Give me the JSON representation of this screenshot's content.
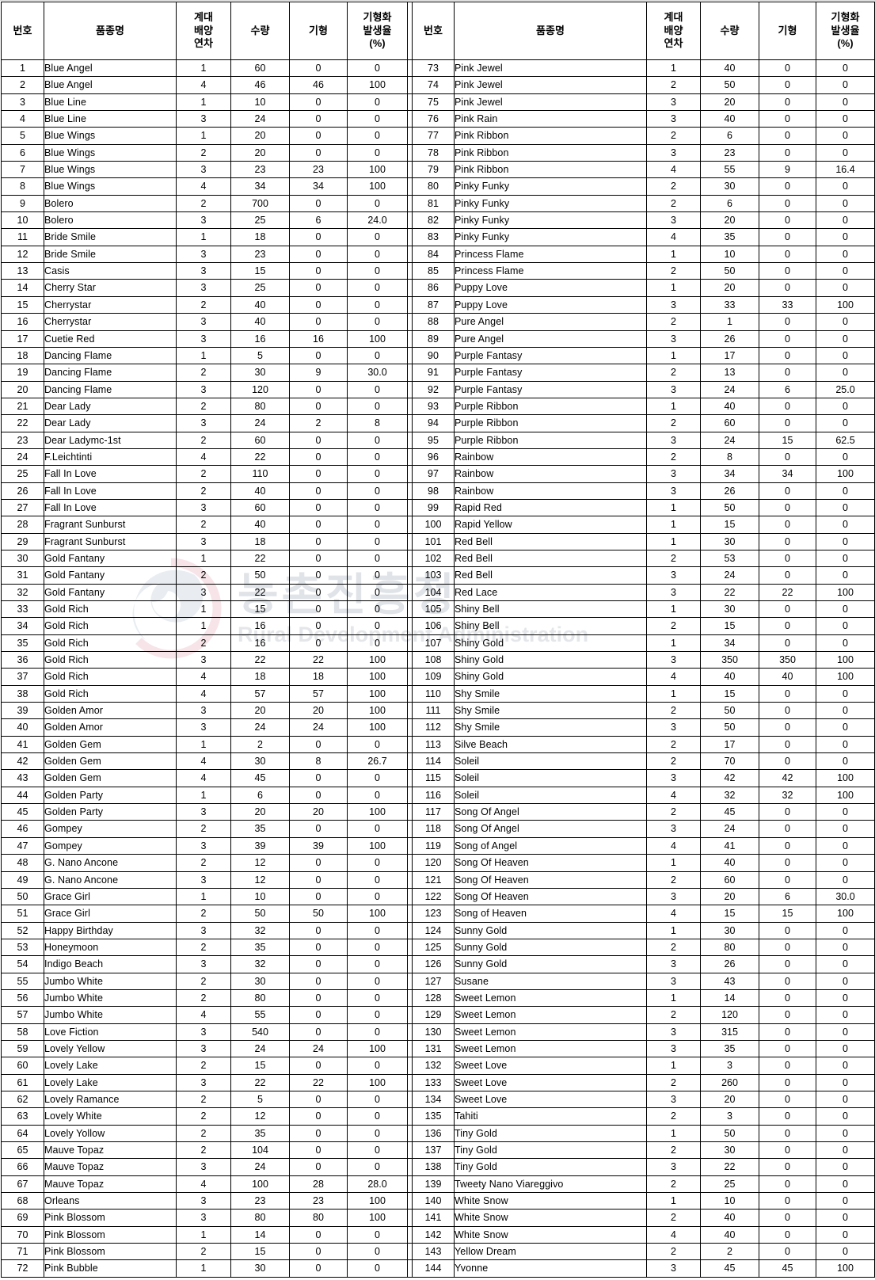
{
  "watermark": {
    "korean_text": "농촌진흥청",
    "english_text": "Rural Development Administration",
    "logo_name": "rda-taegeuk-logo",
    "color": "#9aa5b1"
  },
  "table": {
    "headers": {
      "no": "번호",
      "variety": "품종명",
      "subculture_l1": "계대",
      "subculture_l2": "배양",
      "subculture_l3": "연차",
      "quantity": "수량",
      "malformed": "기형",
      "rate_l1": "기형화",
      "rate_l2": "발생율",
      "rate_l3": "(%)"
    },
    "left_rows": [
      [
        "1",
        "Blue Angel",
        "1",
        "60",
        "0",
        "0"
      ],
      [
        "2",
        "Blue Angel",
        "4",
        "46",
        "46",
        "100"
      ],
      [
        "3",
        "Blue Line",
        "1",
        "10",
        "0",
        "0"
      ],
      [
        "4",
        "Blue Line",
        "3",
        "24",
        "0",
        "0"
      ],
      [
        "5",
        "Blue Wings",
        "1",
        "20",
        "0",
        "0"
      ],
      [
        "6",
        "Blue Wings",
        "2",
        "20",
        "0",
        "0"
      ],
      [
        "7",
        "Blue Wings",
        "3",
        "23",
        "23",
        "100"
      ],
      [
        "8",
        "Blue Wings",
        "4",
        "34",
        "34",
        "100"
      ],
      [
        "9",
        "Bolero",
        "2",
        "700",
        "0",
        "0"
      ],
      [
        "10",
        "Bolero",
        "3",
        "25",
        "6",
        "24.0"
      ],
      [
        "11",
        "Bride Smile",
        "1",
        "18",
        "0",
        "0"
      ],
      [
        "12",
        "Bride Smile",
        "3",
        "23",
        "0",
        "0"
      ],
      [
        "13",
        "Casis",
        "3",
        "15",
        "0",
        "0"
      ],
      [
        "14",
        "Cherry Star",
        "3",
        "25",
        "0",
        "0"
      ],
      [
        "15",
        "Cherrystar",
        "2",
        "40",
        "0",
        "0"
      ],
      [
        "16",
        "Cherrystar",
        "3",
        "40",
        "0",
        "0"
      ],
      [
        "17",
        "Cuetie Red",
        "3",
        "16",
        "16",
        "100"
      ],
      [
        "18",
        "Dancing Flame",
        "1",
        "5",
        "0",
        "0"
      ],
      [
        "19",
        "Dancing Flame",
        "2",
        "30",
        "9",
        "30.0"
      ],
      [
        "20",
        "Dancing Flame",
        "3",
        "120",
        "0",
        "0"
      ],
      [
        "21",
        "Dear Lady",
        "2",
        "80",
        "0",
        "0"
      ],
      [
        "22",
        "Dear Lady",
        "3",
        "24",
        "2",
        "8"
      ],
      [
        "23",
        "Dear Ladymc-1st",
        "2",
        "60",
        "0",
        "0"
      ],
      [
        "24",
        "F.Leichtinti",
        "4",
        "22",
        "0",
        "0"
      ],
      [
        "25",
        "Fall In Love",
        "2",
        "110",
        "0",
        "0"
      ],
      [
        "26",
        "Fall In Love",
        "2",
        "40",
        "0",
        "0"
      ],
      [
        "27",
        "Fall In Love",
        "3",
        "60",
        "0",
        "0"
      ],
      [
        "28",
        "Fragrant Sunburst",
        "2",
        "40",
        "0",
        "0"
      ],
      [
        "29",
        "Fragrant Sunburst",
        "3",
        "18",
        "0",
        "0"
      ],
      [
        "30",
        "Gold Fantany",
        "1",
        "22",
        "0",
        "0"
      ],
      [
        "31",
        "Gold Fantany",
        "2",
        "50",
        "0",
        "0"
      ],
      [
        "32",
        "Gold Fantany",
        "3",
        "22",
        "0",
        "0"
      ],
      [
        "33",
        "Gold Rich",
        "1",
        "15",
        "0",
        "0"
      ],
      [
        "34",
        "Gold Rich",
        "1",
        "16",
        "0",
        "0"
      ],
      [
        "35",
        "Gold Rich",
        "2",
        "16",
        "0",
        "0"
      ],
      [
        "36",
        "Gold Rich",
        "3",
        "22",
        "22",
        "100"
      ],
      [
        "37",
        "Gold Rich",
        "4",
        "18",
        "18",
        "100"
      ],
      [
        "38",
        "Gold Rich",
        "4",
        "57",
        "57",
        "100"
      ],
      [
        "39",
        "Golden Amor",
        "3",
        "20",
        "20",
        "100"
      ],
      [
        "40",
        "Golden Amor",
        "3",
        "24",
        "24",
        "100"
      ],
      [
        "41",
        "Golden Gem",
        "1",
        "2",
        "0",
        "0"
      ],
      [
        "42",
        "Golden Gem",
        "4",
        "30",
        "8",
        "26.7"
      ],
      [
        "43",
        "Golden Gem",
        "4",
        "45",
        "0",
        "0"
      ],
      [
        "44",
        "Golden Party",
        "1",
        "6",
        "0",
        "0"
      ],
      [
        "45",
        "Golden Party",
        "3",
        "20",
        "20",
        "100"
      ],
      [
        "46",
        "Gompey",
        "2",
        "35",
        "0",
        "0"
      ],
      [
        "47",
        "Gompey",
        "3",
        "39",
        "39",
        "100"
      ],
      [
        "48",
        "G. Nano Ancone",
        "2",
        "12",
        "0",
        "0"
      ],
      [
        "49",
        "G. Nano Ancone",
        "3",
        "12",
        "0",
        "0"
      ],
      [
        "50",
        "Grace Girl",
        "1",
        "10",
        "0",
        "0"
      ],
      [
        "51",
        "Grace Girl",
        "2",
        "50",
        "50",
        "100"
      ],
      [
        "52",
        "Happy Birthday",
        "3",
        "32",
        "0",
        "0"
      ],
      [
        "53",
        "Honeymoon",
        "2",
        "35",
        "0",
        "0"
      ],
      [
        "54",
        "Indigo Beach",
        "3",
        "32",
        "0",
        "0"
      ],
      [
        "55",
        "Jumbo White",
        "2",
        "30",
        "0",
        "0"
      ],
      [
        "56",
        "Jumbo White",
        "2",
        "80",
        "0",
        "0"
      ],
      [
        "57",
        "Jumbo White",
        "4",
        "55",
        "0",
        "0"
      ],
      [
        "58",
        "Love Fiction",
        "3",
        "540",
        "0",
        "0"
      ],
      [
        "59",
        "Lovely  Yellow",
        "3",
        "24",
        "24",
        "100"
      ],
      [
        "60",
        "Lovely Lake",
        "2",
        "15",
        "0",
        "0"
      ],
      [
        "61",
        "Lovely Lake",
        "3",
        "22",
        "22",
        "100"
      ],
      [
        "62",
        "Lovely Ramance",
        "2",
        "5",
        "0",
        "0"
      ],
      [
        "63",
        "Lovely White",
        "2",
        "12",
        "0",
        "0"
      ],
      [
        "64",
        "Lovely Yollow",
        "2",
        "35",
        "0",
        "0"
      ],
      [
        "65",
        "Mauve Topaz",
        "2",
        "104",
        "0",
        "0"
      ],
      [
        "66",
        "Mauve Topaz",
        "3",
        "24",
        "0",
        "0"
      ],
      [
        "67",
        "Mauve Topaz",
        "4",
        "100",
        "28",
        "28.0"
      ],
      [
        "68",
        "Orleans",
        "3",
        "23",
        "23",
        "100"
      ],
      [
        "69",
        "Pink  Blossom",
        "3",
        "80",
        "80",
        "100"
      ],
      [
        "70",
        "Pink Blossom",
        "1",
        "14",
        "0",
        "0"
      ],
      [
        "71",
        "Pink Blossom",
        "2",
        "15",
        "0",
        "0"
      ],
      [
        "72",
        "Pink Bubble",
        "1",
        "30",
        "0",
        "0"
      ]
    ],
    "right_rows": [
      [
        "73",
        "Pink Jewel",
        "1",
        "40",
        "0",
        "0"
      ],
      [
        "74",
        "Pink Jewel",
        "2",
        "50",
        "0",
        "0"
      ],
      [
        "75",
        "Pink Jewel",
        "3",
        "20",
        "0",
        "0"
      ],
      [
        "76",
        "Pink Rain",
        "3",
        "40",
        "0",
        "0"
      ],
      [
        "77",
        "Pink Ribbon",
        "2",
        "6",
        "0",
        "0"
      ],
      [
        "78",
        "Pink Ribbon",
        "3",
        "23",
        "0",
        "0"
      ],
      [
        "79",
        "Pink Ribbon",
        "4",
        "55",
        "9",
        "16.4"
      ],
      [
        "80",
        "Pinky Funky",
        "2",
        "30",
        "0",
        "0"
      ],
      [
        "81",
        "Pinky Funky",
        "2",
        "6",
        "0",
        "0"
      ],
      [
        "82",
        "Pinky Funky",
        "3",
        "20",
        "0",
        "0"
      ],
      [
        "83",
        "Pinky Funky",
        "4",
        "35",
        "0",
        "0"
      ],
      [
        "84",
        "Princess Flame",
        "1",
        "10",
        "0",
        "0"
      ],
      [
        "85",
        "Princess Flame",
        "2",
        "50",
        "0",
        "0"
      ],
      [
        "86",
        "Puppy Love",
        "1",
        "20",
        "0",
        "0"
      ],
      [
        "87",
        "Puppy Love",
        "3",
        "33",
        "33",
        "100"
      ],
      [
        "88",
        "Pure Angel",
        "2",
        "1",
        "0",
        "0"
      ],
      [
        "89",
        "Pure Angel",
        "3",
        "26",
        "0",
        "0"
      ],
      [
        "90",
        "Purple Fantasy",
        "1",
        "17",
        "0",
        "0"
      ],
      [
        "91",
        "Purple Fantasy",
        "2",
        "13",
        "0",
        "0"
      ],
      [
        "92",
        "Purple Fantasy",
        "3",
        "24",
        "6",
        "25.0"
      ],
      [
        "93",
        "Purple Ribbon",
        "1",
        "40",
        "0",
        "0"
      ],
      [
        "94",
        "Purple Ribbon",
        "2",
        "60",
        "0",
        "0"
      ],
      [
        "95",
        "Purple Ribbon",
        "3",
        "24",
        "15",
        "62.5"
      ],
      [
        "96",
        "Rainbow",
        "2",
        "8",
        "0",
        "0"
      ],
      [
        "97",
        "Rainbow",
        "3",
        "34",
        "34",
        "100"
      ],
      [
        "98",
        "Rainbow",
        "3",
        "26",
        "0",
        "0"
      ],
      [
        "99",
        "Rapid Red",
        "1",
        "50",
        "0",
        "0"
      ],
      [
        "100",
        "Rapid Yellow",
        "1",
        "15",
        "0",
        "0"
      ],
      [
        "101",
        "Red Bell",
        "1",
        "30",
        "0",
        "0"
      ],
      [
        "102",
        "Red Bell",
        "2",
        "53",
        "0",
        "0"
      ],
      [
        "103",
        "Red Bell",
        "3",
        "24",
        "0",
        "0"
      ],
      [
        "104",
        "Red Lace",
        "3",
        "22",
        "22",
        "100"
      ],
      [
        "105",
        "Shiny Bell",
        "1",
        "30",
        "0",
        "0"
      ],
      [
        "106",
        "Shiny Bell",
        "2",
        "15",
        "0",
        "0"
      ],
      [
        "107",
        "Shiny Gold",
        "1",
        "34",
        "0",
        "0"
      ],
      [
        "108",
        "Shiny Gold",
        "3",
        "350",
        "350",
        "100"
      ],
      [
        "109",
        "Shiny Gold",
        "4",
        "40",
        "40",
        "100"
      ],
      [
        "110",
        "Shy Smile",
        "1",
        "15",
        "0",
        "0"
      ],
      [
        "111",
        "Shy Smile",
        "2",
        "50",
        "0",
        "0"
      ],
      [
        "112",
        "Shy Smile",
        "3",
        "50",
        "0",
        "0"
      ],
      [
        "113",
        "Silve Beach",
        "2",
        "17",
        "0",
        "0"
      ],
      [
        "114",
        "Soleil",
        "2",
        "70",
        "0",
        "0"
      ],
      [
        "115",
        "Soleil",
        "3",
        "42",
        "42",
        "100"
      ],
      [
        "116",
        "Soleil",
        "4",
        "32",
        "32",
        "100"
      ],
      [
        "117",
        "Song Of Angel",
        "2",
        "45",
        "0",
        "0"
      ],
      [
        "118",
        "Song Of Angel",
        "3",
        "24",
        "0",
        "0"
      ],
      [
        "119",
        "Song of Angel",
        "4",
        "41",
        "0",
        "0"
      ],
      [
        "120",
        "Song Of Heaven",
        "1",
        "40",
        "0",
        "0"
      ],
      [
        "121",
        "Song Of Heaven",
        "2",
        "60",
        "0",
        "0"
      ],
      [
        "122",
        "Song Of Heaven",
        "3",
        "20",
        "6",
        "30.0"
      ],
      [
        "123",
        "Song of Heaven",
        "4",
        "15",
        "15",
        "100"
      ],
      [
        "124",
        "Sunny Gold",
        "1",
        "30",
        "0",
        "0"
      ],
      [
        "125",
        "Sunny Gold",
        "2",
        "80",
        "0",
        "0"
      ],
      [
        "126",
        "Sunny Gold",
        "3",
        "26",
        "0",
        "0"
      ],
      [
        "127",
        "Susane",
        "3",
        "43",
        "0",
        "0"
      ],
      [
        "128",
        "Sweet Lemon",
        "1",
        "14",
        "0",
        "0"
      ],
      [
        "129",
        "Sweet Lemon",
        "2",
        "120",
        "0",
        "0"
      ],
      [
        "130",
        "Sweet Lemon",
        "3",
        "315",
        "0",
        "0"
      ],
      [
        "131",
        "Sweet Lemon",
        "3",
        "35",
        "0",
        "0"
      ],
      [
        "132",
        "Sweet Love",
        "1",
        "3",
        "0",
        "0"
      ],
      [
        "133",
        "Sweet Love",
        "2",
        "260",
        "0",
        "0"
      ],
      [
        "134",
        "Sweet Love",
        "3",
        "20",
        "0",
        "0"
      ],
      [
        "135",
        "Tahiti",
        "2",
        "3",
        "0",
        "0"
      ],
      [
        "136",
        "Tiny Gold",
        "1",
        "50",
        "0",
        "0"
      ],
      [
        "137",
        "Tiny Gold",
        "2",
        "30",
        "0",
        "0"
      ],
      [
        "138",
        "Tiny Gold",
        "3",
        "22",
        "0",
        "0"
      ],
      [
        "139",
        "Tweety Nano Viareggivo",
        "2",
        "25",
        "0",
        "0"
      ],
      [
        "140",
        "White Snow",
        "1",
        "10",
        "0",
        "0"
      ],
      [
        "141",
        "White Snow",
        "2",
        "40",
        "0",
        "0"
      ],
      [
        "142",
        "White Snow",
        "4",
        "40",
        "0",
        "0"
      ],
      [
        "143",
        "Yellow Dream",
        "2",
        "2",
        "0",
        "0"
      ],
      [
        "144",
        "Yvonne",
        "3",
        "45",
        "45",
        "100"
      ]
    ]
  }
}
